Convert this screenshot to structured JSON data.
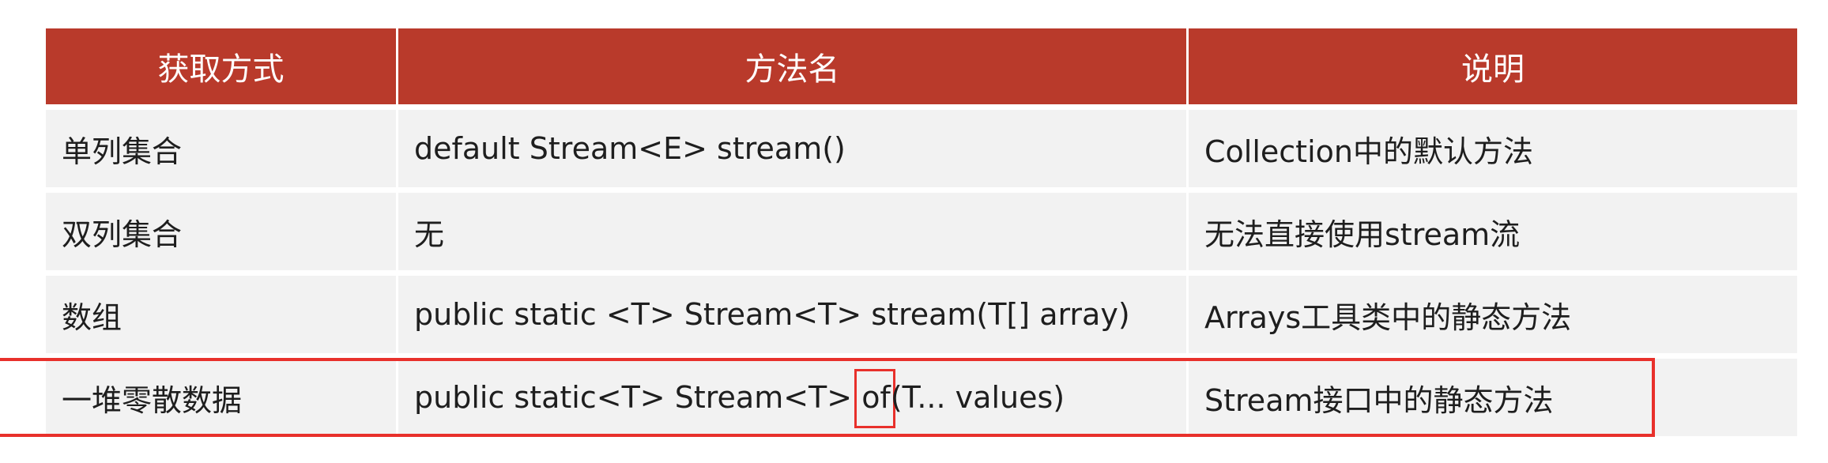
{
  "table": {
    "headers": [
      "获取方式",
      "方法名",
      "说明"
    ],
    "rows": [
      {
        "way": "单列集合",
        "method": "default Stream<E> stream()",
        "desc": "Collection中的默认方法"
      },
      {
        "way": "双列集合",
        "method": "无",
        "desc": "无法直接使用stream流"
      },
      {
        "way": "数组",
        "method": "public static <T> Stream<T> stream(T[] array)",
        "desc": "Arrays工具类中的静态方法"
      },
      {
        "way": "一堆零散数据",
        "method_before": "public static<T> Stream<T> ",
        "method_highlight": "of",
        "method_after": "(T... values)",
        "desc": "Stream接口中的静态方法"
      }
    ]
  },
  "colors": {
    "header_bg": "#b93a2b",
    "header_text": "#ffffff",
    "cell_bg": "#f2f2f2",
    "highlight_border": "#e8302b"
  }
}
